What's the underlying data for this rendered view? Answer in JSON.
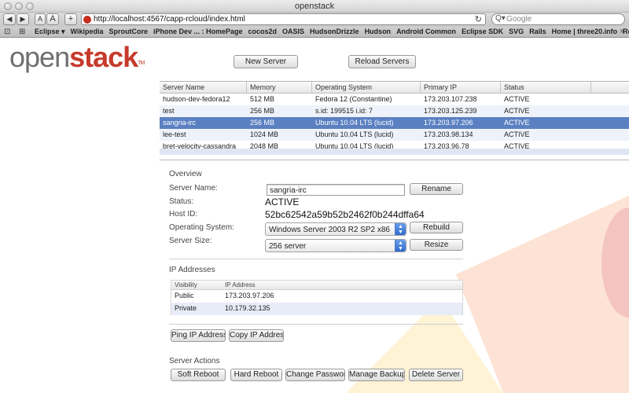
{
  "browser": {
    "window_title": "openstack",
    "nav_back": "◀",
    "nav_forward": "▶",
    "text_small": "A",
    "text_large": "A",
    "add": "+",
    "url": "http://localhost:4567/capp-rcloud/index.html",
    "reload": "↻",
    "search_placeholder": "Google",
    "search_prefix": "Q▾",
    "bookmarks_icon": "⊡",
    "grid_icon": "⊞",
    "bookmarks": [
      "Eclipse ▾",
      "Wikipedia",
      "SproutCore",
      "iPhone Dev ... : HomePage",
      "cocos2d",
      "OASIS",
      "HudsonDrizzle",
      "Hudson",
      "Android Common",
      "Eclipse SDK",
      "SVG",
      "Rails",
      "Home | three20.info",
      "Read Later"
    ],
    "bookmarks_more": "»"
  },
  "app": {
    "logo_lo": "open",
    "logo_hi": "stack",
    "logo_tm": "TM",
    "new_server": "New Server",
    "reload_servers": "Reload Servers"
  },
  "servers": {
    "columns": [
      "Server Name",
      "Memory",
      "Operating System",
      "Primary IP",
      "Status"
    ],
    "rows": [
      [
        "hudson-dev-fedora12",
        "512 MB",
        "Fedora 12 (Constantine)",
        "173.203.107.238",
        "ACTIVE"
      ],
      [
        "test",
        "256 MB",
        "s.id: 199515 i.id: 7",
        "173.203.125.239",
        "ACTIVE"
      ],
      [
        "sangria-irc",
        "256 MB",
        "Ubuntu 10.04 LTS (lucid)",
        "173.203.97.206",
        "ACTIVE"
      ],
      [
        "lee-test",
        "1024 MB",
        "Ubuntu 10.04 LTS (lucid)",
        "173.203.98.134",
        "ACTIVE"
      ],
      [
        "bret-velocity-cassandra",
        "2048 MB",
        "Ubuntu 10.04 LTS (lucid)",
        "173.203.96.78",
        "ACTIVE"
      ]
    ],
    "selected_index": 2
  },
  "overview": {
    "heading": "Overview",
    "server_name_label": "Server Name:",
    "server_name_value": "sangria-irc",
    "rename": "Rename",
    "status_label": "Status:",
    "status_value": "ACTIVE",
    "host_id_label": "Host ID:",
    "host_id_value": "52bc62542a59b52b2462f0b244dffa64",
    "os_label": "Operating System:",
    "os_value": "Windows Server 2003 R2 SP2 x86",
    "rebuild": "Rebuild",
    "size_label": "Server Size:",
    "size_value": "256 server",
    "resize": "Resize",
    "select_arrows": "▲\n▼"
  },
  "ip": {
    "heading": "IP Addresses",
    "columns": [
      "Visibility",
      "IP Address"
    ],
    "rows": [
      [
        "Public",
        "173.203.97.206"
      ],
      [
        "Private",
        "10.179.32.135"
      ]
    ],
    "ping": "Ping IP Address",
    "copy": "Copy IP Address"
  },
  "actions": {
    "heading": "Server Actions",
    "buttons": [
      "Soft Reboot",
      "Hard Reboot",
      "Change Password",
      "Manage Backups",
      "Delete Server"
    ]
  },
  "colors": {
    "accent": "#c63a2b",
    "selection": "#5b80c2",
    "deco_orange": "#fde3d5",
    "deco_red": "#f4c4c0",
    "deco_yellow": "#fff3d6"
  }
}
